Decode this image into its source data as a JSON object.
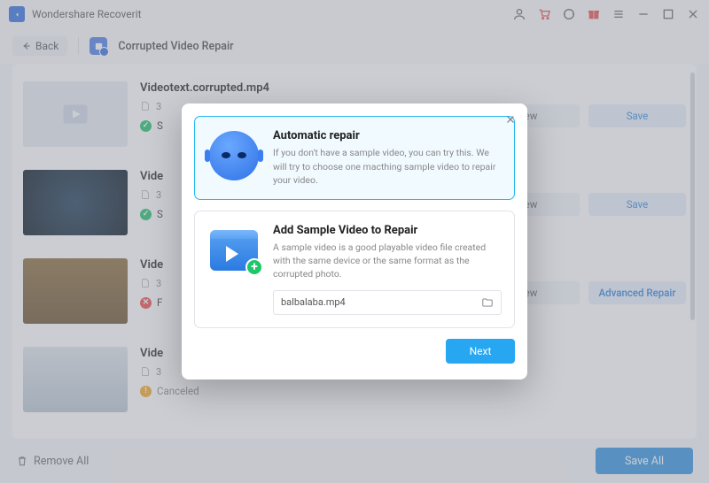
{
  "app": {
    "title": "Wondershare Recoverit"
  },
  "toolbar": {
    "back": "Back",
    "breadcrumb": "Corrupted Video Repair"
  },
  "items": [
    {
      "name": "Videotext.corrupted.mp4",
      "size": "3",
      "status": "ok",
      "status_label": "S",
      "preview": "ew",
      "action": "Save",
      "thumb": "generic"
    },
    {
      "name": "Vide",
      "size": "3",
      "status": "ok",
      "status_label": "S",
      "preview": "ew",
      "action": "Save",
      "thumb": "dark"
    },
    {
      "name": "Vide",
      "size": "3",
      "status": "fail",
      "status_label": "F",
      "preview": "ew",
      "action": "Advanced Repair",
      "thumb": "cathedral"
    },
    {
      "name": "Vide",
      "size": "3",
      "status": "cancel",
      "status_label": "Canceled",
      "thumb": "winter"
    }
  ],
  "footer": {
    "remove_all": "Remove All",
    "save_all": "Save All"
  },
  "modal": {
    "option_auto": {
      "title": "Automatic repair",
      "desc": "If you don't have a sample video, you can try this. We will try to choose one macthing sample video to repair your video."
    },
    "option_sample": {
      "title": "Add Sample Video to Repair",
      "desc": "A sample video is a good playable video file created with the same device or the same format as the corrupted photo.",
      "value": "balbalaba.mp4"
    },
    "next": "Next"
  }
}
